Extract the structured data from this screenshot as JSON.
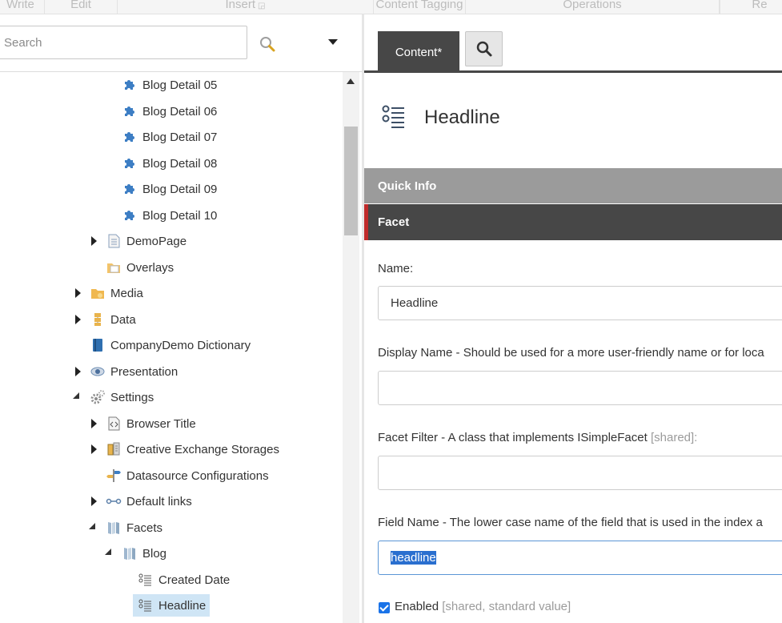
{
  "ribbon": {
    "tabs": [
      "Write",
      "Edit",
      "Insert",
      "Content Tagging",
      "Operations",
      "Re"
    ]
  },
  "left_panel": {
    "search_placeholder": "Search",
    "tree": [
      {
        "label": "Blog Detail 05",
        "icon": "puzzle-icon"
      },
      {
        "label": "Blog Detail 06",
        "icon": "puzzle-icon"
      },
      {
        "label": "Blog Detail 07",
        "icon": "puzzle-icon"
      },
      {
        "label": "Blog Detail 08",
        "icon": "puzzle-icon"
      },
      {
        "label": "Blog Detail 09",
        "icon": "puzzle-icon"
      },
      {
        "label": "Blog Detail 10",
        "icon": "puzzle-icon"
      },
      {
        "label": "DemoPage",
        "icon": "page-icon",
        "toggle": "closed"
      },
      {
        "label": "Overlays",
        "icon": "folder-icon"
      },
      {
        "label": "Media",
        "icon": "media-folder-icon",
        "toggle": "closed"
      },
      {
        "label": "Data",
        "icon": "database-icon",
        "toggle": "closed"
      },
      {
        "label": "CompanyDemo Dictionary",
        "icon": "book-icon"
      },
      {
        "label": "Presentation",
        "icon": "eye-icon",
        "toggle": "closed"
      },
      {
        "label": "Settings",
        "icon": "gears-icon",
        "toggle": "open"
      },
      {
        "label": "Browser Title",
        "icon": "code-page-icon",
        "toggle": "closed"
      },
      {
        "label": "Creative Exchange Storages",
        "icon": "storage-icon",
        "toggle": "closed"
      },
      {
        "label": "Datasource Configurations",
        "icon": "signpost-icon"
      },
      {
        "label": "Default links",
        "icon": "links-icon",
        "toggle": "closed"
      },
      {
        "label": "Facets",
        "icon": "facets-icon",
        "toggle": "open"
      },
      {
        "label": "Blog",
        "icon": "facets-icon",
        "toggle": "open"
      },
      {
        "label": "Created Date",
        "icon": "facet-list-icon"
      },
      {
        "label": "Headline",
        "icon": "facet-list-icon",
        "selected": true
      }
    ]
  },
  "editor": {
    "tabs": {
      "content": "Content*"
    },
    "item_title": "Headline",
    "sections": {
      "quick_info": "Quick Info",
      "facet": "Facet"
    },
    "fields": {
      "name": {
        "label": "Name:",
        "value": "Headline"
      },
      "display_name": {
        "label": "Display Name - Should be used for a more user-friendly name or for loca",
        "value": ""
      },
      "facet_filter": {
        "label": "Facet Filter - A class that implements ISimpleFacet",
        "meta": "[shared]:",
        "value": ""
      },
      "field_name": {
        "label": "Field Name - The lower case name of the field that is used in the index a",
        "value": "headline"
      },
      "enabled": {
        "label": "Enabled",
        "meta": "[shared, standard value]",
        "checked": true
      }
    }
  }
}
